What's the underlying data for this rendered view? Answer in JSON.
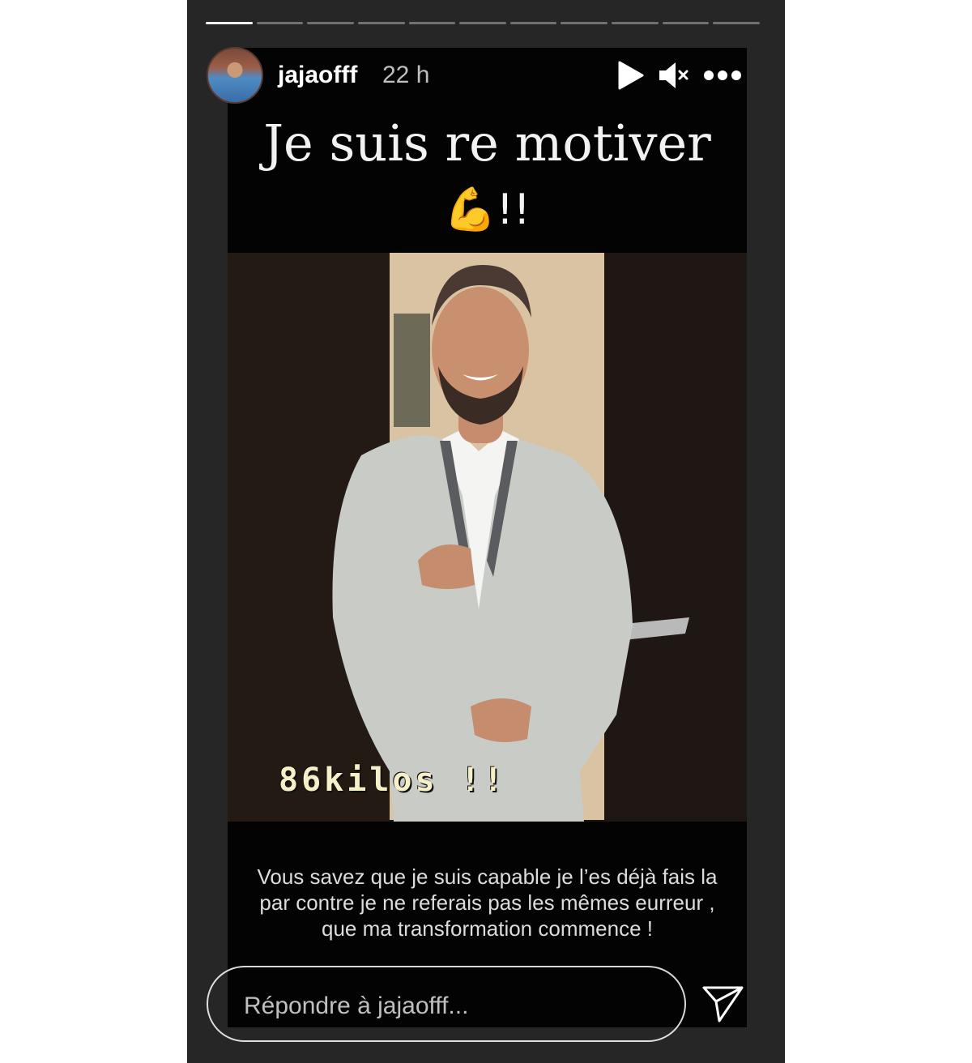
{
  "progress": {
    "total_segments": 11,
    "active_index": 0
  },
  "header": {
    "username": "jajaofff",
    "timestamp": "22 h",
    "icons": [
      "play-icon",
      "mute-icon",
      "more-icon"
    ]
  },
  "story": {
    "headline": "Je suis re motiver",
    "emoji_line": "💪!!",
    "photo_overlay_text": "86kilos !!",
    "caption": "Vous savez que je suis capable je l’es déjà fais la par contre je ne referais pas les mêmes eurreur , que ma transformation commence !"
  },
  "reply": {
    "placeholder": "Répondre à jajaofff...",
    "value": ""
  },
  "colors": {
    "frame_bg": "#262626",
    "story_bg": "#030303",
    "text_primary": "#ffffff",
    "overlay_text": "#f6f0c8"
  }
}
